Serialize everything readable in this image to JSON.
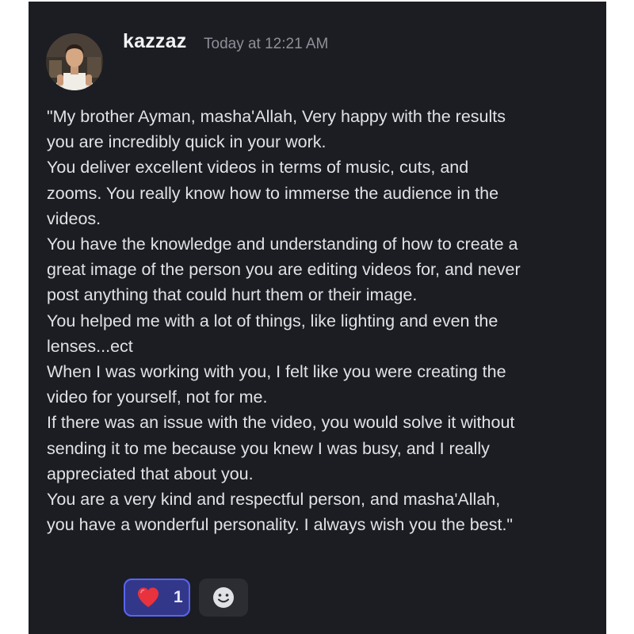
{
  "message": {
    "author": "kazzaz",
    "timestamp": "Today at 12:21 AM",
    "avatar_icon": "user-avatar-photo",
    "lines": [
      "\"My brother Ayman, masha'Allah, Very happy with the results",
      "you are incredibly quick in your work.",
      "You deliver excellent videos in terms of music, cuts, and",
      "zooms. You really know how to immerse the audience in the",
      "videos.",
      "You have the knowledge and understanding of how to create a",
      "great image of the person you are editing videos for, and never",
      "post anything that could hurt them or their image.",
      "You helped me with a lot of things, like lighting and even the",
      "lenses...ect",
      "When I was working with you, I felt like you were creating the",
      "video for yourself, not for me.",
      "If there was an issue with the video, you would solve it without",
      "sending it to me because you knew I was busy, and I really",
      "appreciated that about you.",
      "You are a very kind and respectful person, and masha'Allah,",
      "you have a wonderful personality.  I always wish you the best.\""
    ]
  },
  "reactions": [
    {
      "icon": "red-heart-icon",
      "count": "1",
      "selected": true
    }
  ],
  "add_reaction_icon": "smiley-face-icon",
  "colors": {
    "background": "#1c1d22",
    "accent": "#5865f2",
    "reaction_selected_bg": "#33378a",
    "timestamp": "#8e9099"
  }
}
